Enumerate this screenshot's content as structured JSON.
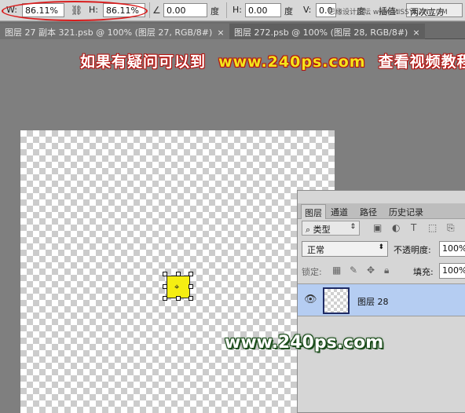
{
  "options_bar": {
    "w_label": "W:",
    "w_value": "86.11%",
    "h_label": "H:",
    "h_value": "86.11%",
    "angle_value": "0.00",
    "angle_unit": "度",
    "hskew_label": "H:",
    "hskew_value": "0.00",
    "hskew_unit": "度",
    "vskew_label": "V:",
    "vskew_value": "0.0",
    "vskew_unit": "度",
    "interp_label": "插值:",
    "interp_value": "两次立方",
    "watermark": "思缘设计论坛 www.MISSYUAN.COM"
  },
  "tabs": [
    {
      "label": "图层 27 副本 321.psb @ 100% (图层 27, RGB/8#)",
      "close": "×"
    },
    {
      "label": "图层 272.psb @ 100% (图层 28, RGB/8#)",
      "close": "×"
    }
  ],
  "header_watermark": {
    "prefix": "如果有疑问可以到",
    "url": "www.240ps.com",
    "suffix": "查看视频教程"
  },
  "layers_panel": {
    "tabs": [
      "图层",
      "通道",
      "路径",
      "历史记录"
    ],
    "filter_label": "类型",
    "blend_mode": "正常",
    "opacity_label": "不透明度:",
    "opacity_value": "100%",
    "lock_label": "锁定:",
    "fill_label": "填充:",
    "fill_value": "100%",
    "layer_name": "图层 28"
  },
  "bottom_watermark": "www.240ps.com",
  "colors": {
    "highlight_oval": "#d91c1c",
    "selected_layer": "#b5cdf2",
    "shape_fill": "#f5ee12"
  }
}
